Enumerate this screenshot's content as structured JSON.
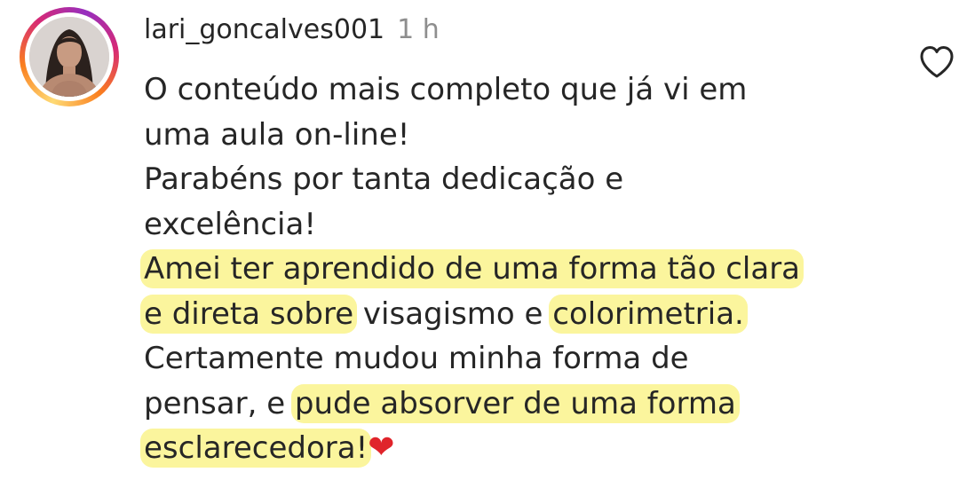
{
  "comment": {
    "username": "lari_goncalves001",
    "time": "1 h",
    "lines": [
      [
        {
          "text": "O conteúdo mais completo que já vi em",
          "hl": false
        }
      ],
      [
        {
          "text": "uma aula on-line!",
          "hl": false
        }
      ],
      [
        {
          "text": "Parabéns por tanta dedicação e",
          "hl": false
        }
      ],
      [
        {
          "text": "excelência!",
          "hl": false
        }
      ],
      [
        {
          "text": "Amei ter aprendido de uma forma tão clara",
          "hl": true
        }
      ],
      [
        {
          "text": "e direta sobre",
          "hl": true
        },
        {
          "text": " visagismo e ",
          "hl": false
        },
        {
          "text": "colorimetria.",
          "hl": true
        }
      ],
      [
        {
          "text": "Certamente mudou minha forma de",
          "hl": false
        }
      ],
      [
        {
          "text": "pensar, e ",
          "hl": false
        },
        {
          "text": "pude absorver de uma forma",
          "hl": true
        }
      ],
      [
        {
          "text": "esclarecedora!",
          "hl": true
        },
        {
          "text": "❤",
          "hl": false,
          "emoji": true
        }
      ]
    ]
  },
  "colors": {
    "highlight": "#fbf59d",
    "text": "#262626",
    "muted": "#8e8e8e",
    "heart_emoji": "#e0242b"
  },
  "icons": {
    "like": "heart-outline-icon",
    "avatar": "profile-photo"
  }
}
